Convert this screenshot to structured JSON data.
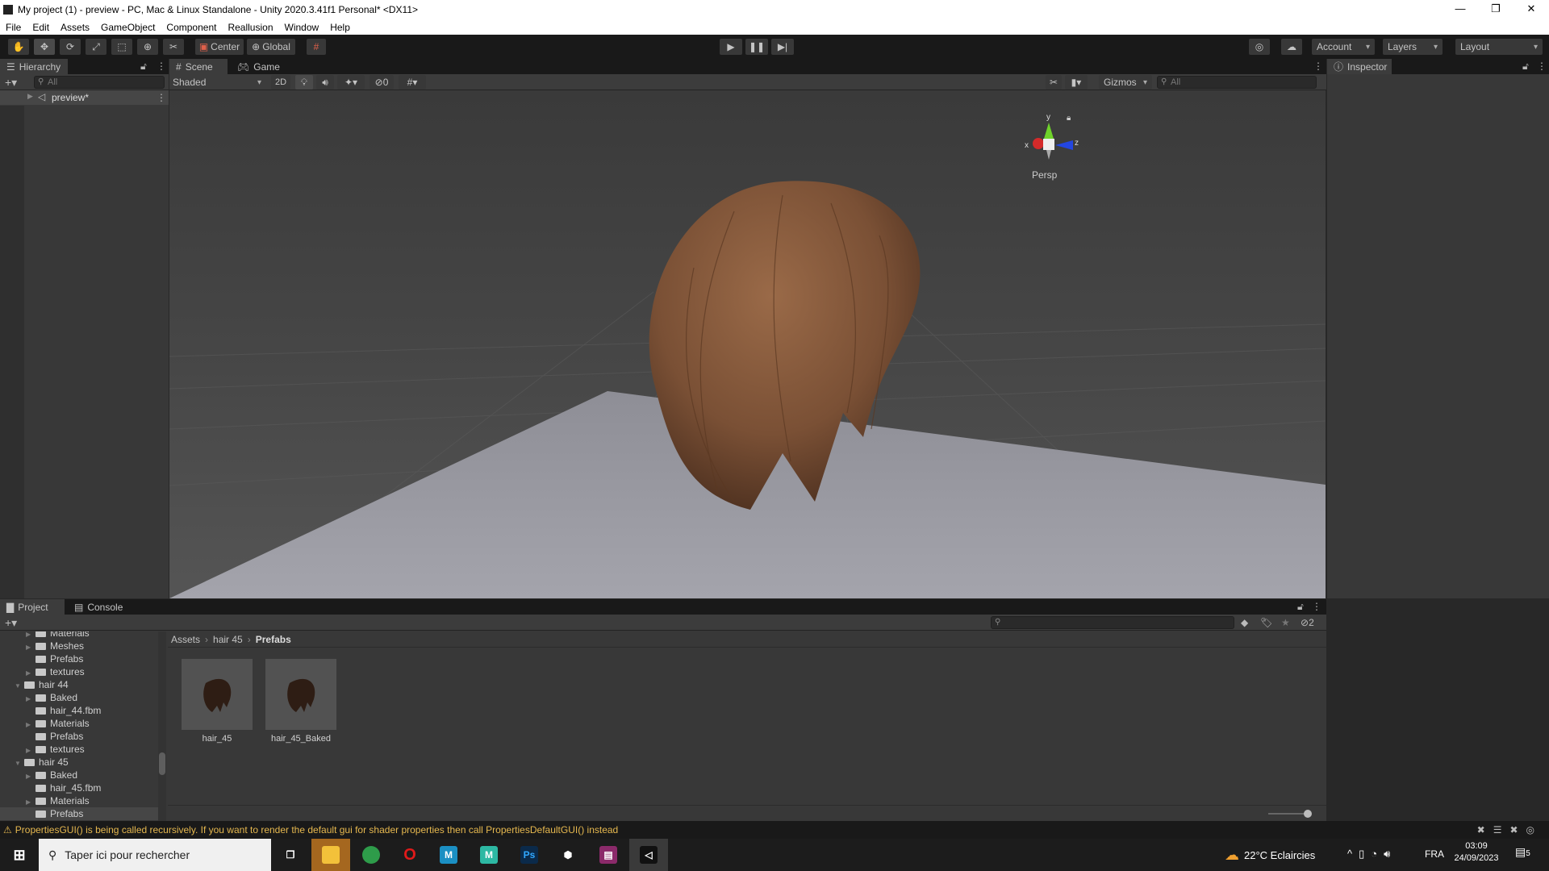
{
  "window": {
    "title": "My project (1) - preview - PC, Mac & Linux Standalone - Unity 2020.3.41f1 Personal* <DX11>",
    "controls": [
      "—",
      "❐",
      "✕"
    ]
  },
  "menu": [
    "File",
    "Edit",
    "Assets",
    "GameObject",
    "Component",
    "Reallusion",
    "Window",
    "Help"
  ],
  "toolbar": {
    "pivot": "Center",
    "space": "Global",
    "account": "Account",
    "layers": "Layers",
    "layout": "Layout"
  },
  "hierarchy": {
    "tab": "Hierarchy",
    "search_placeholder": "All",
    "items": [
      {
        "label": "preview*"
      }
    ]
  },
  "scene": {
    "tabs": [
      "Scene",
      "Game"
    ],
    "shading": "Shaded",
    "mode2d": "2D",
    "hidden_count": "0",
    "gizmos": "Gizmos",
    "search_placeholder": "All",
    "persp": "Persp",
    "axes": {
      "x": "x",
      "y": "y",
      "z": "z"
    }
  },
  "inspector": {
    "tab": "Inspector"
  },
  "project": {
    "tabs": [
      "Project",
      "Console"
    ],
    "hidden_count": "2",
    "tree": [
      {
        "label": "Materials",
        "lvl": 2,
        "arrow": true
      },
      {
        "label": "Meshes",
        "lvl": 2,
        "arrow": true
      },
      {
        "label": "Prefabs",
        "lvl": 2,
        "arrow": false
      },
      {
        "label": "textures",
        "lvl": 2,
        "arrow": true
      },
      {
        "label": "hair 44",
        "lvl": 1,
        "open": true
      },
      {
        "label": "Baked",
        "lvl": 2,
        "arrow": true
      },
      {
        "label": "hair_44.fbm",
        "lvl": 2,
        "arrow": false
      },
      {
        "label": "Materials",
        "lvl": 2,
        "arrow": true
      },
      {
        "label": "Prefabs",
        "lvl": 2,
        "arrow": false
      },
      {
        "label": "textures",
        "lvl": 2,
        "arrow": true
      },
      {
        "label": "hair 45",
        "lvl": 1,
        "open": true
      },
      {
        "label": "Baked",
        "lvl": 2,
        "arrow": true
      },
      {
        "label": "hair_45.fbm",
        "lvl": 2,
        "arrow": false
      },
      {
        "label": "Materials",
        "lvl": 2,
        "arrow": true
      },
      {
        "label": "Prefabs",
        "lvl": 2,
        "arrow": false,
        "selected": true
      }
    ],
    "breadcrumb": [
      "Assets",
      "hair 45",
      "Prefabs"
    ],
    "assets": [
      "hair_45",
      "hair_45_Baked"
    ]
  },
  "status": {
    "message": "PropertiesGUI() is being called recursively. If you want to render the default gui for shader properties then call PropertiesDefaultGUI() instead"
  },
  "taskbar": {
    "search_placeholder": "Taper ici pour rechercher",
    "weather": "22°C  Eclaircies",
    "lang": "FRA",
    "time": "03:09",
    "date": "24/09/2023",
    "notifications": "5"
  }
}
